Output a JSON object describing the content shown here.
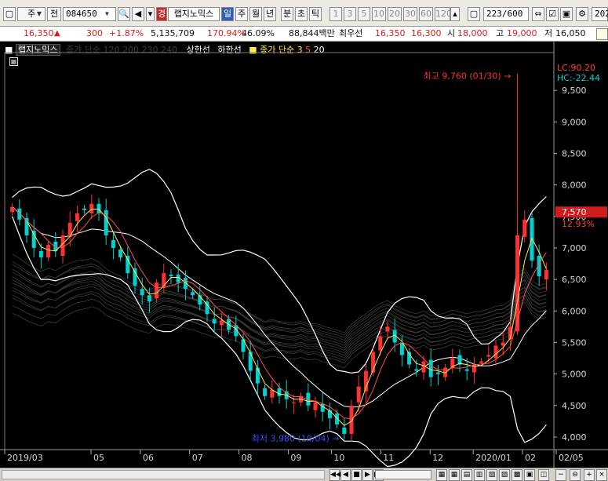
{
  "toolbar": {
    "market": "주",
    "prev_label": "전",
    "code": "084650",
    "name": "랩지노믹스",
    "name_badge": "경",
    "periods": [
      "일",
      "주",
      "월",
      "년",
      "분",
      "초",
      "틱"
    ],
    "active_period": "일",
    "intervals": [
      "1",
      "3",
      "5",
      "10",
      "20",
      "30",
      "60",
      "120"
    ],
    "count": "223",
    "count_total": "/600",
    "date_partial": "202"
  },
  "quote": {
    "price": "16,350",
    "arrow": "▲",
    "change": "300",
    "change_pct": "+1.87%",
    "volume": "5,135,709",
    "vol_ratio": "170.94%",
    "turnover": "46.09%",
    "amount": "88,844백만",
    "pref_label": "최우선",
    "ask": "16,350",
    "bid": "16,300",
    "open_label": "시",
    "open": "18,000",
    "high_label": "고",
    "high": "19,000",
    "low_label": "저",
    "low": "16,050"
  },
  "legend": {
    "title": "랩지노믹스",
    "ma_long": "종가 단순 120 200 230 240",
    "limit_up": "상한선",
    "limit_down": "하한선",
    "ma_short": "종가 단순",
    "ma_short_periods": [
      "3",
      "5",
      "20"
    ]
  },
  "chart_data": {
    "type": "candlestick",
    "y_axis_ticks": [
      "9,500",
      "9,000",
      "8,500",
      "8,000",
      "7,500",
      "7,000",
      "6,500",
      "6,000",
      "5,500",
      "5,000",
      "4,500",
      "4,000"
    ],
    "ylim": [
      3800,
      10100
    ],
    "x_axis_ticks": [
      "2019/03",
      "05",
      "06",
      "07",
      "08",
      "09",
      "10",
      "11",
      "12",
      "2020/01",
      "02",
      "02/05"
    ],
    "annotations": {
      "high": "최고 9,760 (01/30)",
      "low": "최저 3,980 (10/04)",
      "lc": "LC:90.20",
      "hc": "HC:-22.44",
      "last_price": "7,570",
      "last_pct": "12.93%"
    },
    "close_series": [
      7650,
      7450,
      7200,
      7000,
      6850,
      7050,
      6950,
      7200,
      7400,
      7550,
      7600,
      7700,
      7550,
      7200,
      7000,
      6850,
      6600,
      6400,
      6250,
      6150,
      6450,
      6600,
      6550,
      6450,
      6350,
      6250,
      6100,
      5950,
      5800,
      5850,
      5700,
      5600,
      5350,
      5050,
      4850,
      4650,
      4750,
      4650,
      4600,
      4550,
      4650,
      4500,
      4550,
      4400,
      4300,
      4200,
      4050,
      4500,
      4800,
      5050,
      5350,
      5600,
      5750,
      5500,
      5300,
      5150,
      5050,
      5200,
      4950,
      5000,
      5100,
      5250,
      5150,
      5050,
      5150,
      5200,
      5300,
      5450,
      5500,
      5750,
      7200,
      7450,
      6800,
      6550,
      6650
    ]
  },
  "status": {
    "buttons": [
      "◀◀",
      "◀",
      "■",
      "▶",
      "▶▶"
    ]
  },
  "colors": {
    "up": "#ff3232",
    "down": "#00d2d2",
    "axis_text": "#d6d6d6",
    "bollinger": "#ffffff",
    "annotation_high": "#ff3030",
    "annotation_low": "#3a4cff"
  }
}
